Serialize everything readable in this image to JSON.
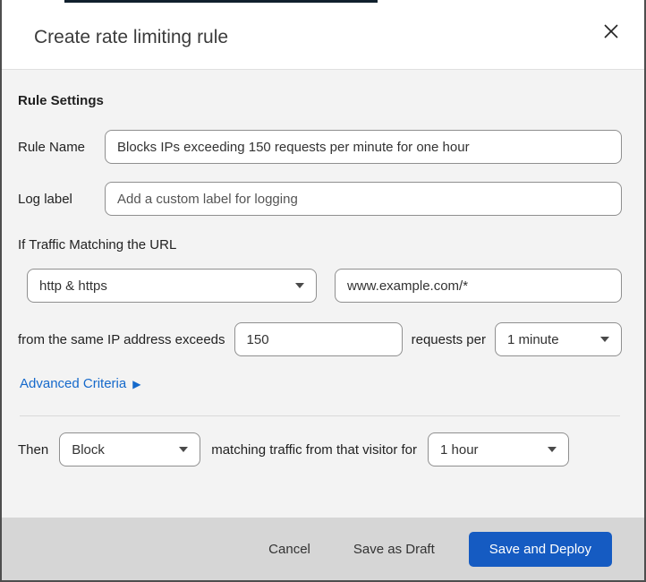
{
  "modal": {
    "title": "Create rate limiting rule",
    "section_heading": "Rule Settings",
    "rule_name": {
      "label": "Rule Name",
      "value": "Blocks IPs exceeding 150 requests per minute for one hour"
    },
    "log_label": {
      "label": "Log label",
      "placeholder": "Add a custom label for logging"
    },
    "traffic_match": {
      "heading": "If Traffic Matching the URL",
      "scheme_select": {
        "value": "http & https"
      },
      "url_input": {
        "value": "www.example.com/*"
      },
      "threshold_prefix": "from the same IP address exceeds",
      "threshold_value": "150",
      "threshold_suffix": "requests per",
      "period_select": {
        "value": "1 minute"
      }
    },
    "advanced_criteria": {
      "label": "Advanced Criteria",
      "arrow": "▶"
    },
    "then": {
      "label": "Then",
      "action_select": {
        "value": "Block"
      },
      "middle_text": "matching traffic from that visitor for",
      "duration_select": {
        "value": "1 hour"
      }
    },
    "footer": {
      "cancel": "Cancel",
      "save_draft": "Save as Draft",
      "save_deploy": "Save and Deploy"
    },
    "colors": {
      "primary_button_blue": "#155bc2",
      "link_blue": "#1569cb",
      "top_accent_dark": "#10202d"
    }
  }
}
